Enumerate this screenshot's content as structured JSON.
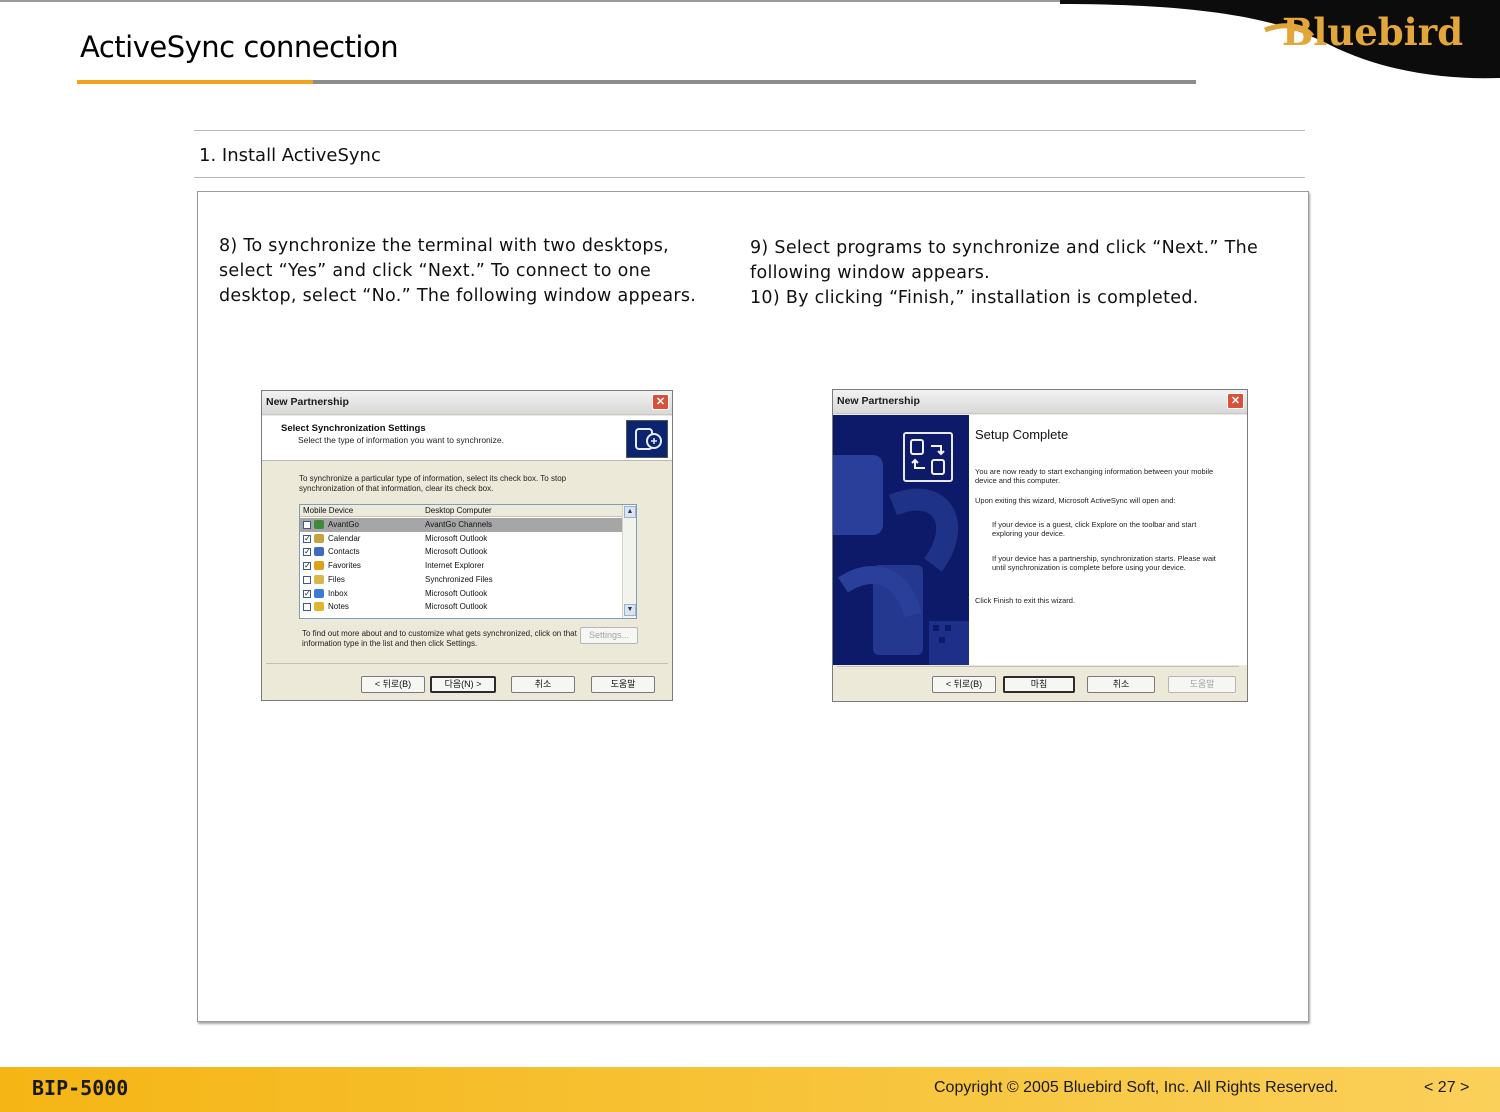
{
  "header": {
    "title": "ActiveSync connection",
    "logo_text": "Bluebird",
    "accent_color": "#f3a21b"
  },
  "section": {
    "heading": "1. Install ActiveSync"
  },
  "steps": {
    "left": "8) To synchronize the terminal with two desktops, select “Yes” and click “Next.” To connect to one desktop, select “No.” The following window appears.",
    "right_line1": "9) Select programs to synchronize and click “Next.” The following window appears.",
    "right_line2": "10) By clicking  “Finish,” installation is completed."
  },
  "dialog_sync": {
    "window_title": "New Partnership",
    "close_icon": "✕",
    "header_title": "Select Synchronization Settings",
    "header_subtitle": "Select the type of information you want to synchronize.",
    "instructions": "To synchronize a particular type of information, select its check box. To stop synchronization of that information, clear its check box.",
    "columns": [
      "Mobile Device",
      "Desktop Computer"
    ],
    "rows": [
      {
        "checked": false,
        "mobile": "AvantGo",
        "desktop": "AvantGo Channels",
        "selected": true,
        "icon_color": "#3f8a3a"
      },
      {
        "checked": true,
        "mobile": "Calendar",
        "desktop": "Microsoft Outlook",
        "selected": false,
        "icon_color": "#c6a33e"
      },
      {
        "checked": true,
        "mobile": "Contacts",
        "desktop": "Microsoft Outlook",
        "selected": false,
        "icon_color": "#3f6cc0"
      },
      {
        "checked": true,
        "mobile": "Favorites",
        "desktop": "Internet Explorer",
        "selected": false,
        "icon_color": "#e0a11a"
      },
      {
        "checked": false,
        "mobile": "Files",
        "desktop": "Synchronized Files",
        "selected": false,
        "icon_color": "#d9b64a"
      },
      {
        "checked": true,
        "mobile": "Inbox",
        "desktop": "Microsoft Outlook",
        "selected": false,
        "icon_color": "#3a7bd5"
      },
      {
        "checked": false,
        "mobile": "Notes",
        "desktop": "Microsoft Outlook",
        "selected": false,
        "icon_color": "#e3b42d"
      }
    ],
    "footer_text": "To find out more about and to customize what gets synchronized, click on that information type in the list and then click Settings.",
    "buttons": {
      "settings": "Settings...",
      "back": "< 뒤로(B)",
      "next": "다음(N) >",
      "cancel": "취소",
      "help": "도움말"
    }
  },
  "dialog_complete": {
    "window_title": "New Partnership",
    "close_icon": "✕",
    "heading": "Setup Complete",
    "para1": "You are now ready to start exchanging information between your mobile device and this computer.",
    "para2": "Upon exiting this wizard, Microsoft ActiveSync will open and:",
    "bullet1": "If your device is a guest, click Explore on the toolbar and start exploring your device.",
    "bullet2": "If your device has a partnership, synchronization starts. Please wait until synchronization is complete before using your device.",
    "para3": "Click Finish to exit this wizard.",
    "buttons": {
      "back": "< 뒤로(B)",
      "finish": "마침",
      "cancel": "취소",
      "help": "도움말"
    }
  },
  "footer": {
    "model": "BIP-5000",
    "copyright": "Copyright © 2005 Bluebird Soft, Inc. All Rights Reserved.",
    "page": "< 27 >",
    "bar_color": "#f5b515"
  }
}
